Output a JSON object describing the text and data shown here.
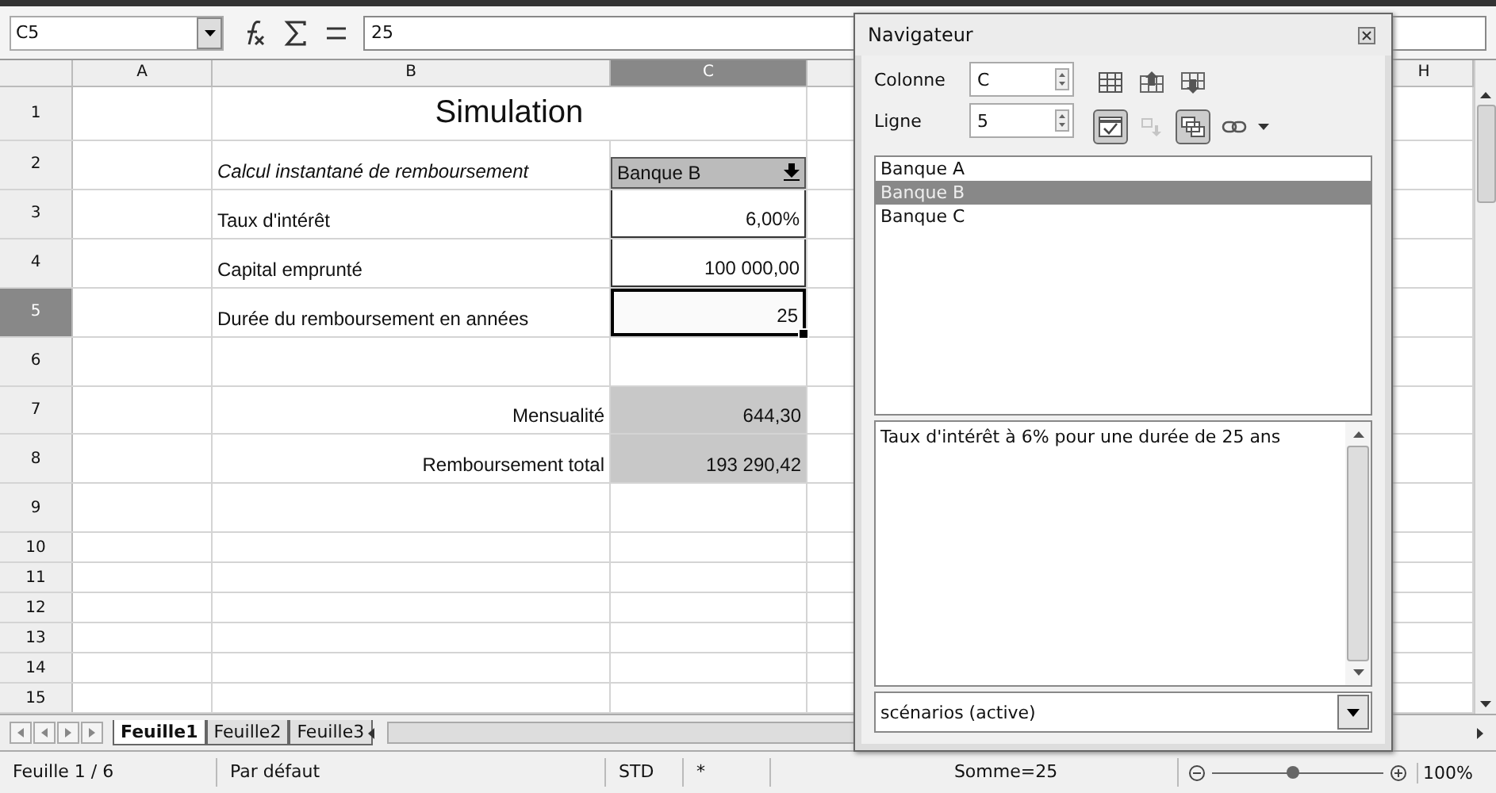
{
  "formula_bar": {
    "cell_ref": "C5",
    "formula": "25"
  },
  "columns": [
    {
      "label": "A",
      "selected": false
    },
    {
      "label": "B",
      "selected": false
    },
    {
      "label": "C",
      "selected": true
    },
    {
      "label": "H",
      "selected": false
    }
  ],
  "rows": [
    {
      "number": "1",
      "selected": false,
      "label": {
        "text": "Simulation",
        "kind": "title"
      }
    },
    {
      "number": "2",
      "selected": false,
      "label": {
        "text": "Calcul instantané de remboursement",
        "kind": "italic"
      },
      "value": {
        "text": "Banque B",
        "kind": "scenario"
      }
    },
    {
      "number": "3",
      "selected": false,
      "label": {
        "text": "Taux d'intérêt",
        "kind": "plain"
      },
      "value": {
        "text": "6,00%",
        "kind": "input",
        "selected": false
      }
    },
    {
      "number": "4",
      "selected": false,
      "label": {
        "text": "Capital emprunté",
        "kind": "plain"
      },
      "value": {
        "text": "100 000,00",
        "kind": "input",
        "selected": false
      }
    },
    {
      "number": "5",
      "selected": true,
      "label": {
        "text": "Durée du remboursement en années",
        "kind": "plain"
      },
      "value": {
        "text": "25",
        "kind": "input",
        "selected": true
      }
    },
    {
      "number": "6",
      "selected": false
    },
    {
      "number": "7",
      "selected": false,
      "label": {
        "text": "Mensualité",
        "kind": "right"
      },
      "value": {
        "text": "644,30",
        "kind": "result"
      }
    },
    {
      "number": "8",
      "selected": false,
      "label": {
        "text": "Remboursement total",
        "kind": "right"
      },
      "value": {
        "text": "193 290,42",
        "kind": "result"
      }
    },
    {
      "number": "9",
      "selected": false
    },
    {
      "number": "10",
      "selected": false
    },
    {
      "number": "11",
      "selected": false
    },
    {
      "number": "12",
      "selected": false
    },
    {
      "number": "13",
      "selected": false
    },
    {
      "number": "14",
      "selected": false
    },
    {
      "number": "15",
      "selected": false
    }
  ],
  "sheet_tabs": [
    {
      "label": "Feuille1",
      "selected": true
    },
    {
      "label": "Feuille2",
      "selected": false
    },
    {
      "label": "Feuille3",
      "selected": false
    }
  ],
  "navigator": {
    "title": "Navigateur",
    "column_label": "Colonne",
    "column_value": "C",
    "row_label": "Ligne",
    "row_value": "5",
    "toolbar": [
      {
        "pressed": false,
        "disabled": false
      },
      {
        "pressed": false,
        "disabled": false
      },
      {
        "pressed": false,
        "disabled": false
      },
      {
        "pressed": true,
        "disabled": false
      },
      {
        "pressed": false,
        "disabled": true
      },
      {
        "pressed": true,
        "disabled": false
      },
      {
        "pressed": false,
        "disabled": false
      }
    ],
    "items": [
      {
        "label": "Banque A",
        "selected": false
      },
      {
        "label": "Banque B",
        "selected": true
      },
      {
        "label": "Banque C",
        "selected": false
      }
    ],
    "comment": "Taux d'intérêt à 6% pour une durée de 25 ans",
    "document": "scénarios (active)"
  },
  "status_bar": {
    "sheet": "Feuille 1 / 6",
    "style": "Par défaut",
    "mode": "STD",
    "modified": "*",
    "sum": "Somme=25",
    "zoom": {
      "level": 0.47,
      "value": "100%"
    }
  }
}
